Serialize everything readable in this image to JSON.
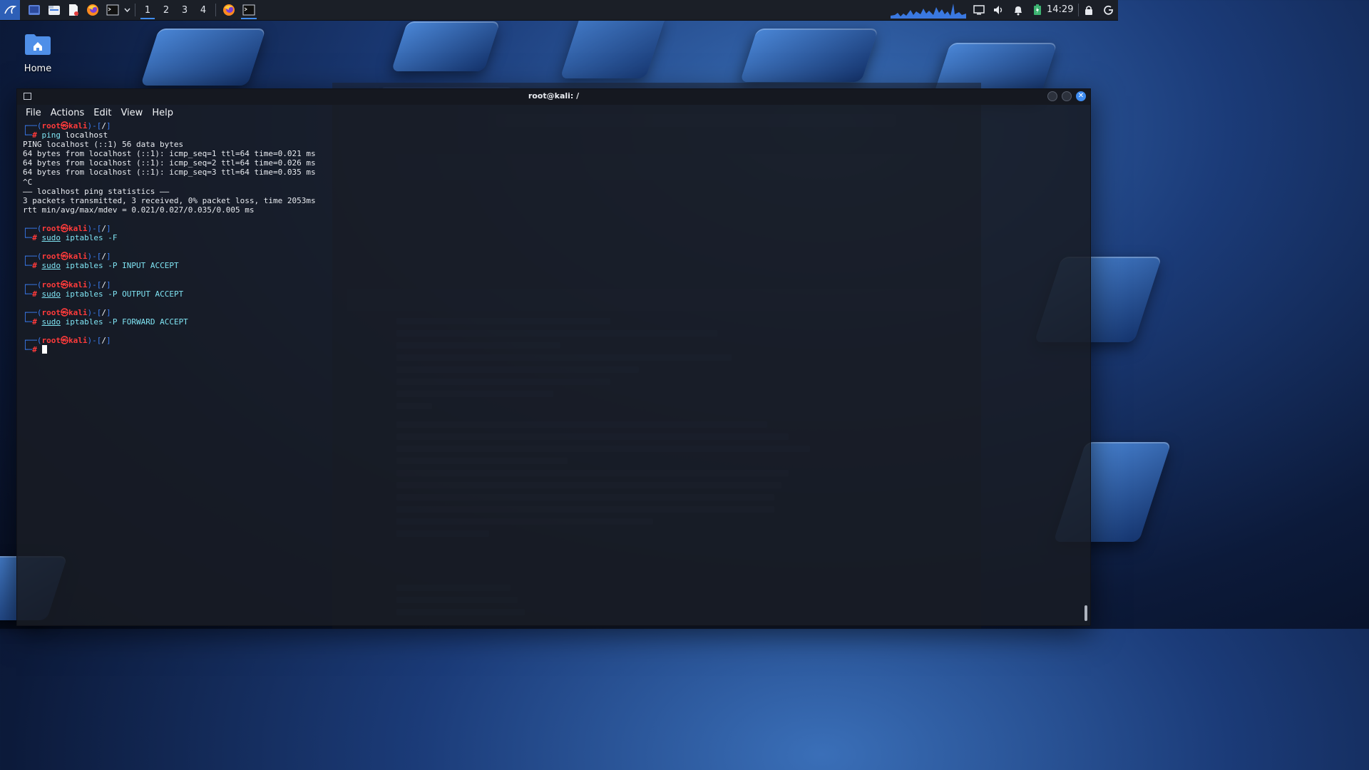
{
  "desktop": {
    "home_label": "Home"
  },
  "panel": {
    "workspaces": [
      "1",
      "2",
      "3",
      "4"
    ],
    "active_workspace": "1",
    "clock": "14:29",
    "icons": [
      "kali-menu-icon",
      "show-desktop-icon",
      "file-manager-icon",
      "text-editor-icon",
      "firefox-icon",
      "terminal-icon",
      "dropdown-icon"
    ]
  },
  "terminal": {
    "title": "root@kali: /",
    "menu": [
      "File",
      "Actions",
      "Edit",
      "View",
      "Help"
    ],
    "prompt": {
      "user": "root",
      "at": "㉿",
      "host": "kali",
      "dir": "/"
    },
    "blocks": [
      {
        "command": "ping",
        "args": " localhost",
        "output": [
          "PING localhost (::1) 56 data bytes",
          "64 bytes from localhost (::1): icmp_seq=1 ttl=64 time=0.021 ms",
          "64 bytes from localhost (::1): icmp_seq=2 ttl=64 time=0.026 ms",
          "64 bytes from localhost (::1): icmp_seq=3 ttl=64 time=0.035 ms",
          "^C",
          "—— localhost ping statistics ——",
          "3 packets transmitted, 3 received, 0% packet loss, time 2053ms",
          "rtt min/avg/max/mdev = 0.021/0.027/0.035/0.005 ms"
        ]
      },
      {
        "command": "sudo",
        "args": " iptables -F",
        "output": []
      },
      {
        "command": "sudo",
        "args": " iptables -P INPUT ACCEPT",
        "output": []
      },
      {
        "command": "sudo",
        "args": " iptables -P OUTPUT ACCEPT",
        "output": []
      },
      {
        "command": "sudo",
        "args": " iptables -P FORWARD ACCEPT",
        "output": []
      }
    ]
  },
  "colors": {
    "accent": "#3f8cf0",
    "prompt_user": "#ff3b3b",
    "prompt_frame": "#3a7cf0",
    "command": "#7fe3f2"
  }
}
